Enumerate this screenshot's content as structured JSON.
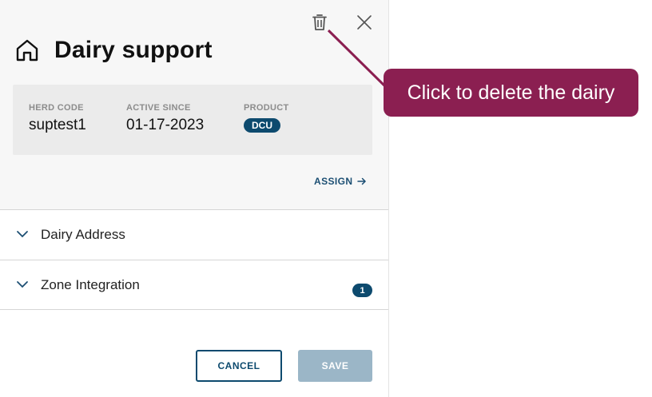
{
  "dialog": {
    "title": "Dairy support",
    "icons": {
      "home": "home-icon",
      "delete": "trash-icon",
      "close": "close-icon"
    },
    "info": {
      "herd_code_label": "HERD CODE",
      "herd_code_value": "suptest1",
      "active_since_label": "ACTIVE SINCE",
      "active_since_value": "01-17-2023",
      "product_label": "PRODUCT",
      "product_value": "DCU"
    },
    "assign_label": "ASSIGN",
    "sections": [
      {
        "label": "Dairy Address"
      },
      {
        "label": "Zone Integration",
        "count": "1"
      }
    ],
    "cancel_label": "CANCEL",
    "save_label": "SAVE"
  },
  "callout": {
    "text": "Click to delete the dairy"
  },
  "colors": {
    "accent": "#0d4a6e",
    "callout": "#8b1f51",
    "save_disabled": "#9bb6c7"
  }
}
